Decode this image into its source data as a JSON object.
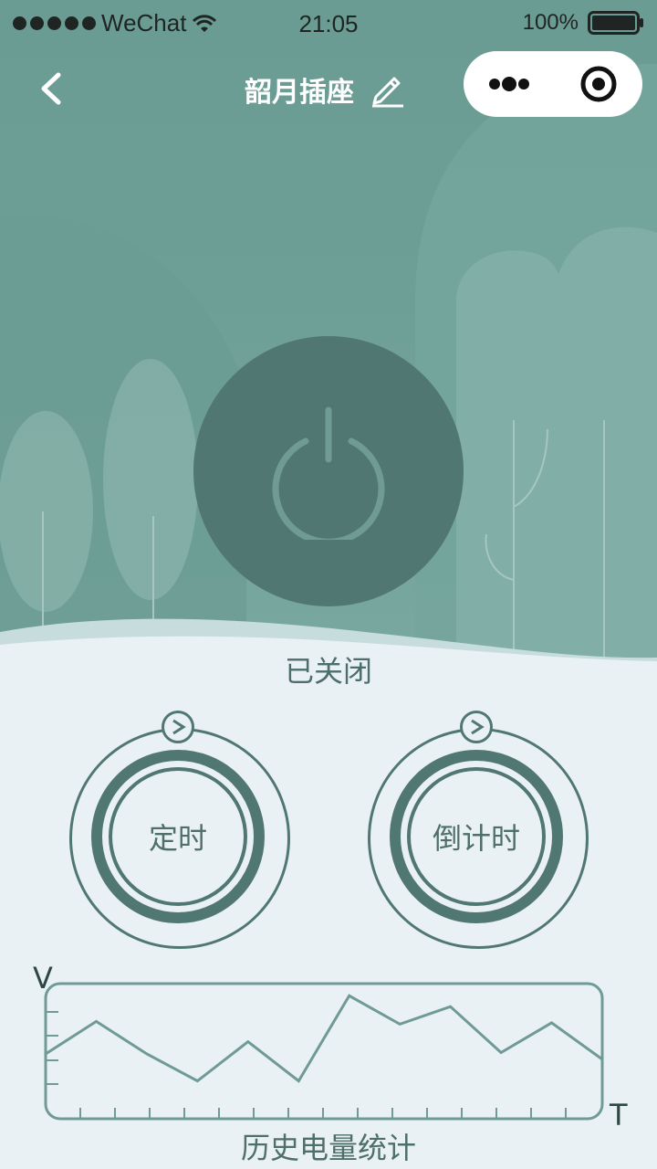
{
  "status_bar": {
    "carrier": "WeChat",
    "time": "21:05",
    "battery": "100%"
  },
  "nav": {
    "title": "韶月插座"
  },
  "device": {
    "status": "已关闭",
    "power_on": false
  },
  "dials": [
    {
      "label": "定时"
    },
    {
      "label": "倒计时"
    }
  ],
  "chart": {
    "title": "历史电量统计",
    "y_axis_label": "V",
    "x_axis_label": "T"
  },
  "chart_data": {
    "type": "line",
    "title": "历史电量统计",
    "xlabel": "T",
    "ylabel": "V",
    "x": [
      0,
      1,
      2,
      3,
      4,
      5,
      6,
      7,
      8,
      9,
      10,
      11,
      12
    ],
    "series": [
      {
        "values": [
          0.48,
          0.72,
          0.48,
          0.28,
          0.57,
          0.28,
          0.91,
          0.7,
          0.83,
          0.49,
          0.71,
          0.44
        ]
      }
    ],
    "ylim": [
      0,
      1
    ],
    "grid": false
  },
  "colors": {
    "accent": "#517772",
    "hero_bg": "#6e9f97",
    "page_bg": "#e9f1f4",
    "chart_line": "#6f9a95"
  },
  "icons": {
    "back": "chevron-left-icon",
    "edit": "pencil-icon",
    "more": "more-dots-icon",
    "close": "target-close-icon",
    "power": "power-icon",
    "arrow": "arrow-right-icon"
  }
}
